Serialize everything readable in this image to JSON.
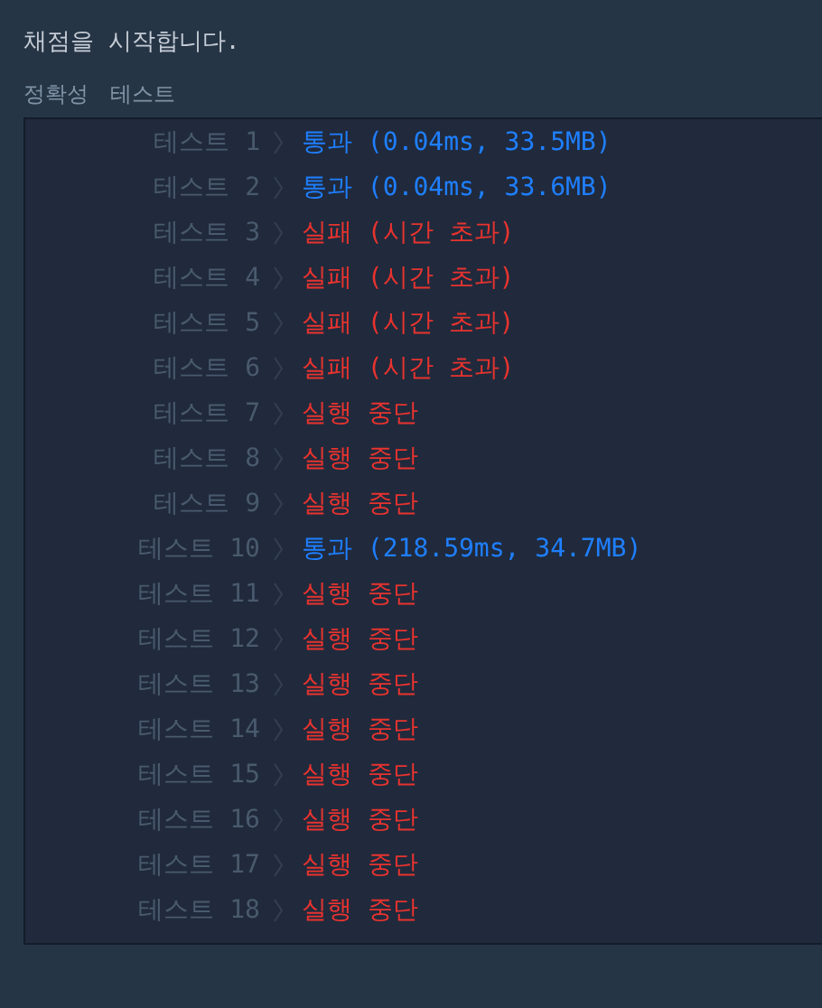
{
  "header": "채점을 시작합니다.",
  "section_tabs": [
    "정확성",
    "테스트"
  ],
  "results": [
    {
      "label": "테스트 1",
      "kind": "pass",
      "result": "통과 (0.04ms, 33.5MB)"
    },
    {
      "label": "테스트 2",
      "kind": "pass",
      "result": "통과 (0.04ms, 33.6MB)"
    },
    {
      "label": "테스트 3",
      "kind": "fail",
      "result": "실패 (시간 초과)"
    },
    {
      "label": "테스트 4",
      "kind": "fail",
      "result": "실패 (시간 초과)"
    },
    {
      "label": "테스트 5",
      "kind": "fail",
      "result": "실패 (시간 초과)"
    },
    {
      "label": "테스트 6",
      "kind": "fail",
      "result": "실패 (시간 초과)"
    },
    {
      "label": "테스트 7",
      "kind": "fail",
      "result": "실행 중단"
    },
    {
      "label": "테스트 8",
      "kind": "fail",
      "result": "실행 중단"
    },
    {
      "label": "테스트 9",
      "kind": "fail",
      "result": "실행 중단"
    },
    {
      "label": "테스트 10",
      "kind": "pass",
      "result": "통과 (218.59ms, 34.7MB)"
    },
    {
      "label": "테스트 11",
      "kind": "fail",
      "result": "실행 중단"
    },
    {
      "label": "테스트 12",
      "kind": "fail",
      "result": "실행 중단"
    },
    {
      "label": "테스트 13",
      "kind": "fail",
      "result": "실행 중단"
    },
    {
      "label": "테스트 14",
      "kind": "fail",
      "result": "실행 중단"
    },
    {
      "label": "테스트 15",
      "kind": "fail",
      "result": "실행 중단"
    },
    {
      "label": "테스트 16",
      "kind": "fail",
      "result": "실행 중단"
    },
    {
      "label": "테스트 17",
      "kind": "fail",
      "result": "실행 중단"
    },
    {
      "label": "테스트 18",
      "kind": "fail",
      "result": "실행 중단"
    }
  ]
}
